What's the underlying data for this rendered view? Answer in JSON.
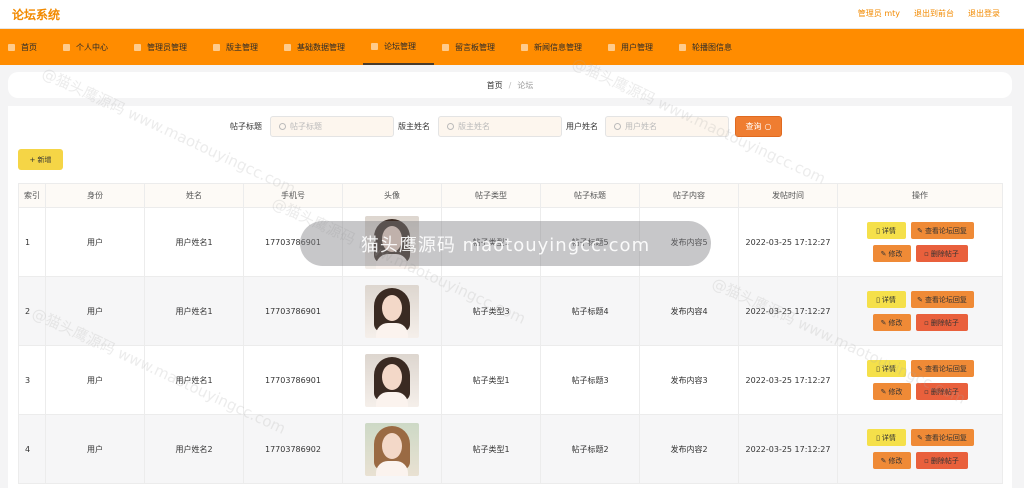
{
  "header": {
    "title": "论坛系统",
    "user_label": "管理员 mty",
    "back_label": "退出到前台",
    "logout_label": "退出登录"
  },
  "nav": [
    {
      "label": "首页",
      "icon": "home-icon"
    },
    {
      "label": "个人中心",
      "icon": "user-icon"
    },
    {
      "label": "管理员管理",
      "icon": "admin-icon"
    },
    {
      "label": "版主管理",
      "icon": "moderator-icon"
    },
    {
      "label": "基础数据管理",
      "icon": "data-icon"
    },
    {
      "label": "论坛管理",
      "icon": "forum-icon",
      "active": true
    },
    {
      "label": "留言板管理",
      "icon": "message-icon"
    },
    {
      "label": "新闻信息管理",
      "icon": "news-icon"
    },
    {
      "label": "用户管理",
      "icon": "users-icon"
    },
    {
      "label": "轮播图信息",
      "icon": "carousel-icon"
    }
  ],
  "breadcrumb": {
    "home": "首页",
    "separator": "/",
    "current": "论坛"
  },
  "search": {
    "title_label": "帖子标题",
    "title_placeholder": "帖子标题",
    "mod_label": "版主姓名",
    "mod_placeholder": "版主姓名",
    "user_label": "用户姓名",
    "user_placeholder": "用户姓名",
    "query_label": "查询"
  },
  "add_label": "+ 新增",
  "table": {
    "columns": [
      "索引",
      "身份",
      "姓名",
      "手机号",
      "头像",
      "帖子类型",
      "帖子标题",
      "帖子内容",
      "发帖时间",
      "操作"
    ],
    "rows": [
      {
        "idx": "1",
        "role": "用户",
        "name": "用户姓名1",
        "phone": "17703786901",
        "type": "帖子类型1",
        "title": "帖子标题5",
        "content": "发布内容5",
        "time": "2022-03-25 17:12:27"
      },
      {
        "idx": "2",
        "role": "用户",
        "name": "用户姓名1",
        "phone": "17703786901",
        "type": "帖子类型3",
        "title": "帖子标题4",
        "content": "发布内容4",
        "time": "2022-03-25 17:12:27"
      },
      {
        "idx": "3",
        "role": "用户",
        "name": "用户姓名1",
        "phone": "17703786901",
        "type": "帖子类型1",
        "title": "帖子标题3",
        "content": "发布内容3",
        "time": "2022-03-25 17:12:27"
      },
      {
        "idx": "4",
        "role": "用户",
        "name": "用户姓名2",
        "phone": "17703786902",
        "type": "帖子类型1",
        "title": "帖子标题2",
        "content": "发布内容2",
        "time": "2022-03-25 17:12:27"
      }
    ],
    "actions": {
      "detail": "详情",
      "reply": "查看论坛回复",
      "edit": "修改",
      "delete": "删除帖子"
    }
  },
  "overlay_text": "猫头鹰源码 maotouyingcc.com",
  "watermark": "@猫头鹰源码 www.maotouyingcc.com",
  "colors": {
    "brand": "#f28a00",
    "nav_bg": "#ff8c00",
    "query_btn": "#ef7d31",
    "add_btn": "#f5d546"
  }
}
